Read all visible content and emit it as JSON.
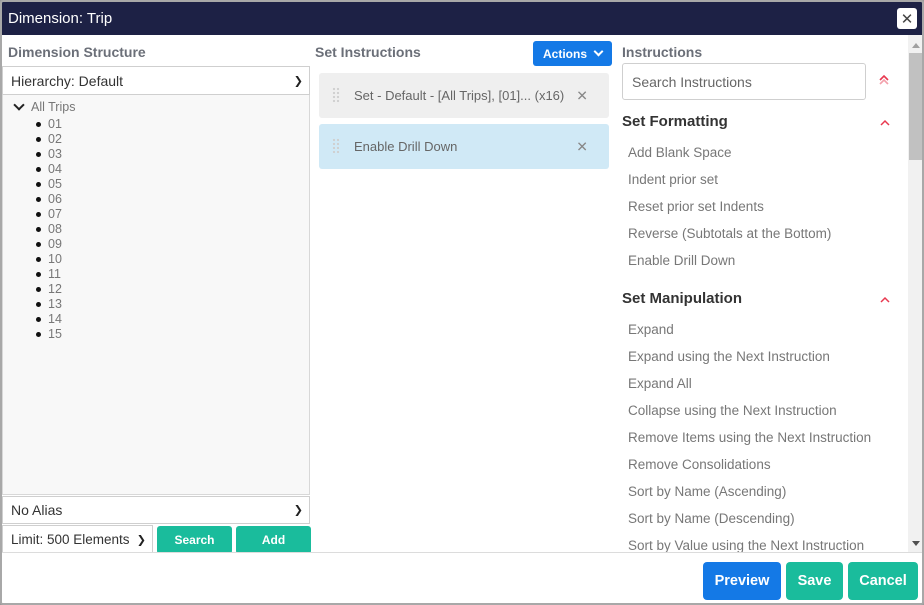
{
  "window": {
    "title": "Dimension: Trip",
    "close_icon": "close-icon"
  },
  "structure": {
    "heading": "Dimension Structure",
    "hierarchy_select": "Hierarchy: Default",
    "tree": {
      "root": "All Trips",
      "children": [
        "01",
        "02",
        "03",
        "04",
        "05",
        "06",
        "07",
        "08",
        "09",
        "10",
        "11",
        "12",
        "13",
        "14",
        "15"
      ]
    },
    "alias_select": "No Alias",
    "limit_select": "Limit: 500 Elements",
    "search_label": "Search",
    "add_label": "Add"
  },
  "set_instructions": {
    "heading": "Set Instructions",
    "actions_label": "Actions",
    "items": [
      {
        "label": "Set - Default - [All Trips], [01]... (x16)",
        "state": "default"
      },
      {
        "label": "Enable Drill Down",
        "state": "selected"
      }
    ]
  },
  "instructions": {
    "heading": "Instructions",
    "search_placeholder": "Search Instructions",
    "groups": [
      {
        "title": "Set Formatting",
        "expanded": true,
        "items": [
          "Add Blank Space",
          "Indent prior set",
          "Reset prior set Indents",
          "Reverse (Subtotals at the Bottom)",
          "Enable Drill Down"
        ]
      },
      {
        "title": "Set Manipulation",
        "expanded": true,
        "items": [
          "Expand",
          "Expand using the Next Instruction",
          "Expand All",
          "Collapse using the Next Instruction",
          "Remove Items using the Next Instruction",
          "Remove Consolidations",
          "Sort by Name (Ascending)",
          "Sort by Name (Descending)",
          "Sort by Value using the Next Instruction"
        ]
      }
    ]
  },
  "footer": {
    "preview_label": "Preview",
    "save_label": "Save",
    "cancel_label": "Cancel"
  },
  "colors": {
    "titlebar": "#1d2145",
    "primary": "#1479e6",
    "success": "#1abc9c",
    "selected_card": "#d0e9f6",
    "toggle_accent": "#e8384f"
  }
}
